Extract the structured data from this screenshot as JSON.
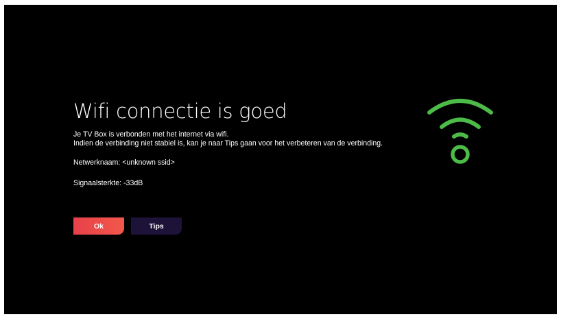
{
  "dialog": {
    "title": "Wifi connectie is goed",
    "description_lines": [
      "Je TV Box is verbonden met het internet via wifi.",
      "Indien de verbinding niet stabiel is, kan je naar Tips gaan voor het verbeteren van de verbinding."
    ],
    "network_name": "Netwerknaam: <unknown ssid>",
    "signal_strength": "Signaalsterkte: -33dB"
  },
  "buttons": {
    "ok_label": "Ok",
    "tips_label": "Tips"
  },
  "icon": {
    "name": "wifi-icon",
    "color": "#4cbb47"
  },
  "colors": {
    "background": "#000000",
    "ok_button": "#ef4f4a",
    "tips_button": "#1d1238"
  }
}
